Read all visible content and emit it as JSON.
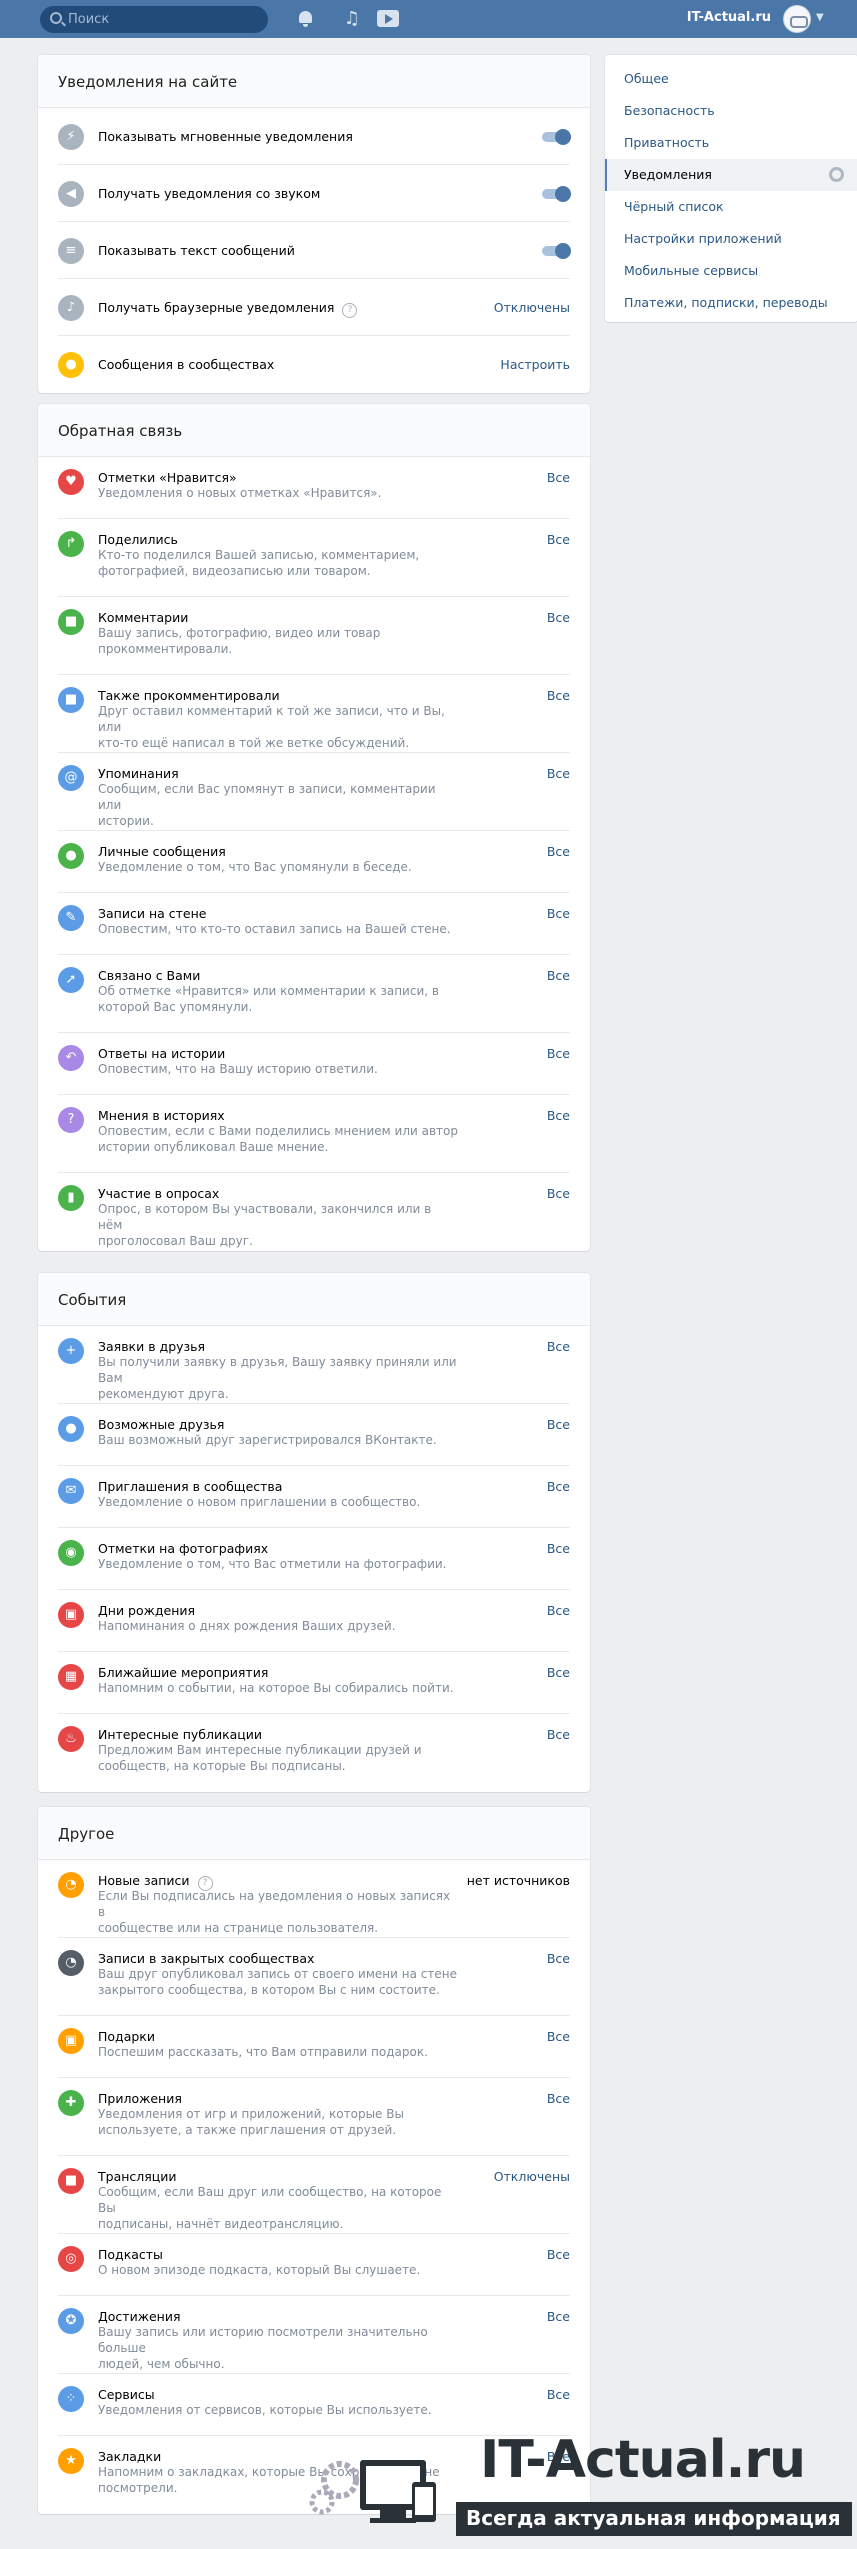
{
  "header": {
    "search_placeholder": "Поиск",
    "username": "IT-Actual.ru",
    "icons": [
      "bell-icon",
      "music-icon",
      "video-icon"
    ]
  },
  "sidebar": {
    "items": [
      {
        "label": "Общее"
      },
      {
        "label": "Безопасность"
      },
      {
        "label": "Приватность"
      },
      {
        "label": "Уведомления"
      },
      {
        "label": "Чёрный список"
      },
      {
        "label": "Настройки приложений"
      },
      {
        "label": "Мобильные сервисы"
      },
      {
        "label": "Платежи, подписки, переводы"
      }
    ],
    "active_index": 3
  },
  "site_notifications": {
    "title": "Уведомления на сайте",
    "rows": [
      {
        "label": "Показывать мгновенные уведомления",
        "icon": "lightning-icon",
        "color": "#aab4bf",
        "toggle": true
      },
      {
        "label": "Получать уведомления со звуком",
        "icon": "speaker-icon",
        "color": "#aab4bf",
        "toggle": true
      },
      {
        "label": "Показывать текст сообщений",
        "icon": "lines-icon",
        "color": "#aab4bf",
        "toggle": true
      },
      {
        "label": "Получать браузерные уведомления",
        "icon": "bell-icon",
        "color": "#aab4bf",
        "help": "?",
        "value": "Отключены"
      },
      {
        "label": "Сообщения в сообществах",
        "icon": "group-icon",
        "color": "#ffc107",
        "value": "Настроить"
      }
    ]
  },
  "feedback": {
    "title": "Обратная связь",
    "rows": [
      {
        "label": "Отметки «Нравится»",
        "desc": [
          "Уведомления о новых отметках «Нравится»."
        ],
        "value": "Все",
        "icon": "heart-icon",
        "color": "#e64646"
      },
      {
        "label": "Поделились",
        "desc": [
          "Кто-то поделился Вашей записью, комментарием,",
          "фотографией, видеозаписью или товаром."
        ],
        "value": "Все",
        "icon": "share-icon",
        "color": "#4bb34b"
      },
      {
        "label": "Комментарии",
        "desc": [
          "Вашу запись, фотографию, видео или товар",
          "прокомментировали."
        ],
        "value": "Все",
        "icon": "comment-icon",
        "color": "#4bb34b"
      },
      {
        "label": "Также прокомментировали",
        "desc": [
          "Друг оставил комментарий к той же записи, что и Вы, или",
          "кто-то ещё написал в той же ветке обсуждений."
        ],
        "value": "Все",
        "icon": "comments-icon",
        "color": "#5c9ce6"
      },
      {
        "label": "Упоминания",
        "desc": [
          "Сообщим, если Вас упомянут в записи, комментарии или",
          "истории."
        ],
        "value": "Все",
        "icon": "at-icon",
        "color": "#5c9ce6"
      },
      {
        "label": "Личные сообщения",
        "desc": [
          "Уведомление о том, что Вас упомянули в беседе."
        ],
        "value": "Все",
        "icon": "message-icon",
        "color": "#4bb34b"
      },
      {
        "label": "Записи на стене",
        "desc": [
          "Оповестим, что кто-то оставил запись на Вашей стене."
        ],
        "value": "Все",
        "icon": "pencil-icon",
        "color": "#5c9ce6"
      },
      {
        "label": "Связано с Вами",
        "desc": [
          "Об отметке «Нравится» или комментарии к записи, в",
          "которой Вас упомянули."
        ],
        "value": "Все",
        "icon": "compass-icon",
        "color": "#5c9ce6"
      },
      {
        "label": "Ответы на истории",
        "desc": [
          "Оповестим, что на Вашу историю ответили."
        ],
        "value": "Все",
        "icon": "reply-icon",
        "color": "#a88ae6"
      },
      {
        "label": "Мнения в историях",
        "desc": [
          "Оповестим, если с Вами поделились мнением или автор",
          "истории опубликовал Ваше мнение."
        ],
        "value": "Все",
        "icon": "question-icon",
        "color": "#a88ae6"
      },
      {
        "label": "Участие в опросах",
        "desc": [
          "Опрос, в котором Вы участвовали, закончился или в нём",
          "проголосовал Ваш друг."
        ],
        "value": "Все",
        "icon": "poll-icon",
        "color": "#4bb34b"
      }
    ]
  },
  "events": {
    "title": "События",
    "rows": [
      {
        "label": "Заявки в друзья",
        "desc": [
          "Вы получили заявку в друзья, Вашу заявку приняли или Вам",
          "рекомендуют друга."
        ],
        "value": "Все",
        "icon": "plus-icon",
        "color": "#5c9ce6"
      },
      {
        "label": "Возможные друзья",
        "desc": [
          "Ваш возможный друг зарегистрировался ВКонтакте."
        ],
        "value": "Все",
        "icon": "user-icon",
        "color": "#5c9ce6"
      },
      {
        "label": "Приглашения в сообщества",
        "desc": [
          "Уведомление о новом приглашении в сообщество."
        ],
        "value": "Все",
        "icon": "mail-icon",
        "color": "#5c9ce6"
      },
      {
        "label": "Отметки на фотографиях",
        "desc": [
          "Уведомление о том, что Вас отметили на фотографии."
        ],
        "value": "Все",
        "icon": "camera-icon",
        "color": "#4bb34b"
      },
      {
        "label": "Дни рождения",
        "desc": [
          "Напоминания о днях рождения Ваших друзей."
        ],
        "value": "Все",
        "icon": "gift-icon",
        "color": "#e64646"
      },
      {
        "label": "Ближайшие мероприятия",
        "desc": [
          "Напомним о событии, на которое Вы собирались пойти."
        ],
        "value": "Все",
        "icon": "calendar-icon",
        "color": "#e64646"
      },
      {
        "label": "Интересные публикации",
        "desc": [
          "Предложим Вам интересные публикации друзей и",
          "сообществ, на которые Вы подписаны."
        ],
        "value": "Все",
        "icon": "fire-icon",
        "color": "#e64646"
      }
    ]
  },
  "other": {
    "title": "Другое",
    "rows": [
      {
        "label": "Новые записи",
        "help": "?",
        "desc": [
          "Если Вы подписались на уведомления о новых записях в",
          "сообществе или на странице пользователя."
        ],
        "value": "нет источников",
        "value_plain": true,
        "icon": "rss-icon",
        "color": "#ffa000"
      },
      {
        "label": "Записи в закрытых сообществах",
        "desc": [
          "Ваш друг опубликовал запись от своего имени на стене",
          "закрытого сообщества, в котором Вы с ним состоите."
        ],
        "value": "Все",
        "icon": "rss-dark-icon",
        "color": "#555d66"
      },
      {
        "label": "Подарки",
        "desc": [
          "Поспешим рассказать, что Вам отправили подарок."
        ],
        "value": "Все",
        "icon": "gift-icon",
        "color": "#ffa000"
      },
      {
        "label": "Приложения",
        "desc": [
          "Уведомления от игр и приложений, которые Вы",
          "используете, а также приглашения от друзей."
        ],
        "value": "Все",
        "icon": "gamepad-icon",
        "color": "#4bb34b"
      },
      {
        "label": "Трансляции",
        "desc": [
          "Сообщим, если Ваш друг или сообщество, на которое Вы",
          "подписаны, начнёт видеотрансляцию."
        ],
        "value": "Отключены",
        "icon": "video-camera-icon",
        "color": "#e64646"
      },
      {
        "label": "Подкасты",
        "desc": [
          "О новом эпизоде подкаста, который Вы слушаете."
        ],
        "value": "Все",
        "icon": "podcast-icon",
        "color": "#e64646"
      },
      {
        "label": "Достижения",
        "desc": [
          "Вашу запись или историю посмотрели значительно больше",
          "людей, чем обычно."
        ],
        "value": "Все",
        "icon": "medal-icon",
        "color": "#5c9ce6"
      },
      {
        "label": "Сервисы",
        "desc": [
          "Уведомления от сервисов, которые Вы используете."
        ],
        "value": "Все",
        "icon": "services-icon",
        "color": "#5c9ce6"
      },
      {
        "label": "Закладки",
        "desc": [
          "Напомним о закладках, которые Вы сохранили, но не",
          "посмотрели."
        ],
        "value": "Все",
        "icon": "star-icon",
        "color": "#ffa000"
      }
    ]
  },
  "watermark": {
    "title": "IT-Actual.ru",
    "subtitle": "Всегда актуальная информация"
  }
}
